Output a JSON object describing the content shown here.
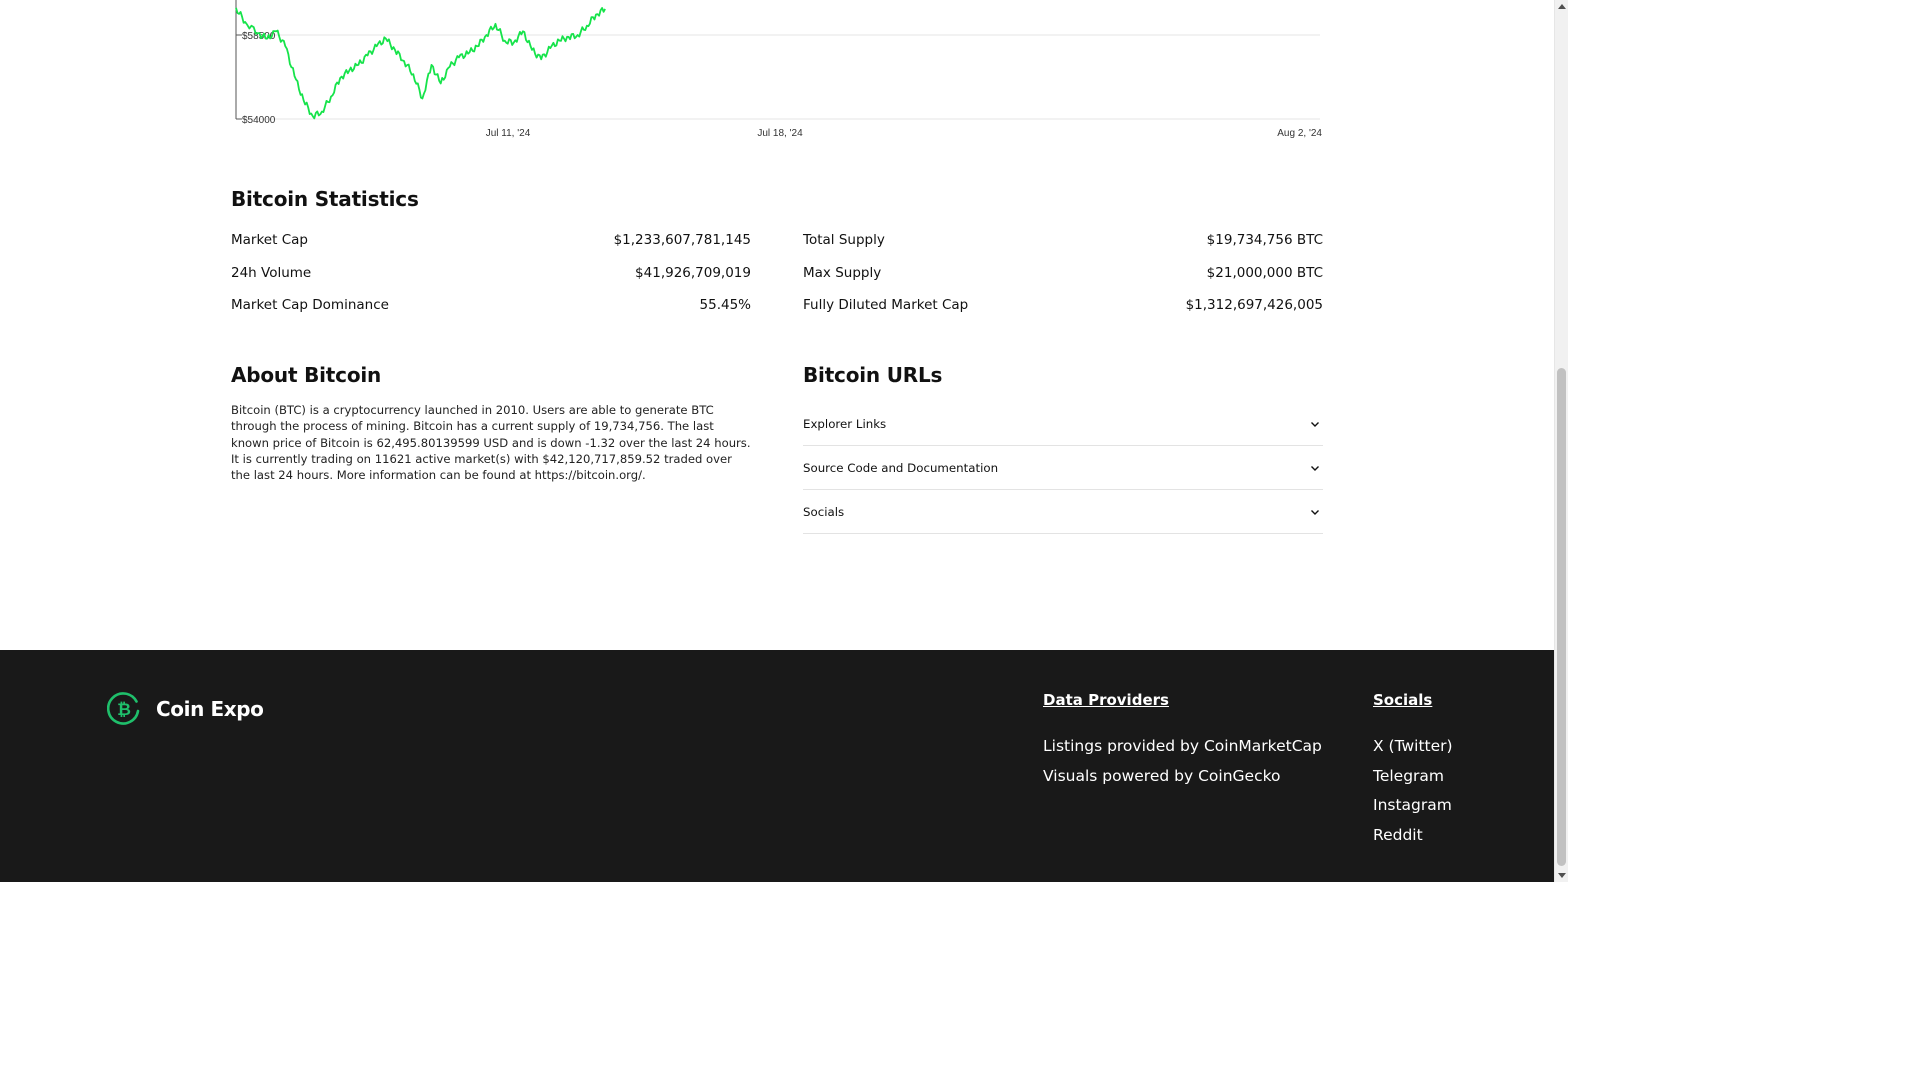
{
  "chart_data": {
    "type": "line",
    "x_ticks": [
      "Jul 11, '24",
      "Jul 18, '24",
      "Aug 2, '24"
    ],
    "y_ticks": [
      "$58500",
      "$54000"
    ],
    "series": [
      {
        "color": "#16e34a",
        "values": [
          [
            0,
            59950
          ],
          [
            0.5,
            59200
          ],
          [
            1.2,
            58600
          ],
          [
            1.7,
            58300
          ],
          [
            2.2,
            58700
          ],
          [
            2.7,
            57900
          ],
          [
            3.2,
            56300
          ],
          [
            3.7,
            55000
          ],
          [
            4.2,
            54150
          ],
          [
            4.7,
            54400
          ],
          [
            5.2,
            55200
          ],
          [
            5.7,
            56200
          ],
          [
            6.2,
            56600
          ],
          [
            6.7,
            56900
          ],
          [
            7.2,
            57400
          ],
          [
            7.7,
            57900
          ],
          [
            8.2,
            58300
          ],
          [
            8.7,
            57700
          ],
          [
            9.2,
            57100
          ],
          [
            9.7,
            56400
          ],
          [
            10.2,
            55100
          ],
          [
            10.7,
            56900
          ],
          [
            11.2,
            55900
          ],
          [
            11.7,
            56800
          ],
          [
            12.2,
            57300
          ],
          [
            12.7,
            57500
          ],
          [
            13.2,
            57900
          ],
          [
            13.7,
            58500
          ],
          [
            14.2,
            59100
          ],
          [
            14.7,
            58200
          ],
          [
            15.2,
            58100
          ],
          [
            15.7,
            58700
          ],
          [
            16.2,
            57700
          ],
          [
            16.7,
            57200
          ],
          [
            17.2,
            57800
          ],
          [
            17.7,
            58200
          ],
          [
            18.2,
            58400
          ],
          [
            18.7,
            58500
          ],
          [
            19.2,
            59000
          ],
          [
            19.7,
            59600
          ],
          [
            20.2,
            59900
          ]
        ]
      }
    ]
  },
  "stats": {
    "title": "Bitcoin Statistics",
    "left": [
      {
        "label": "Market Cap",
        "value": "$1,233,607,781,145"
      },
      {
        "label": "24h Volume",
        "value": "$41,926,709,019"
      },
      {
        "label": "Market Cap Dominance",
        "value": "55.45%"
      }
    ],
    "right": [
      {
        "label": "Total Supply",
        "value": "$19,734,756 BTC"
      },
      {
        "label": "Max Supply",
        "value": "$21,000,000 BTC"
      },
      {
        "label": "Fully Diluted Market Cap",
        "value": "$1,312,697,426,005"
      }
    ]
  },
  "about": {
    "title": "About Bitcoin",
    "text": "Bitcoin (BTC) is a cryptocurrency launched in 2010. Users are able to generate BTC through the process of mining. Bitcoin has a current supply of 19,734,756. The last known price of Bitcoin is 62,495.80139599 USD and is down -1.32 over the last 24 hours. It is currently trading on 11621 active market(s) with $42,120,717,859.52 traded over the last 24 hours. More information can be found at https://bitcoin.org/."
  },
  "urls": {
    "title": "Bitcoin URLs",
    "items": [
      {
        "label": "Explorer Links"
      },
      {
        "label": "Source Code and Documentation"
      },
      {
        "label": "Socials"
      }
    ]
  },
  "footer": {
    "brand": "Coin Expo",
    "brand_color": "#1fbf6b",
    "providers": {
      "title": "Data Providers",
      "links": [
        "Listings provided by CoinMarketCap",
        "Visuals powered by CoinGecko"
      ]
    },
    "socials": {
      "title": "Socials",
      "links": [
        "X (Twitter)",
        "Telegram",
        "Instagram",
        "Reddit"
      ]
    }
  }
}
